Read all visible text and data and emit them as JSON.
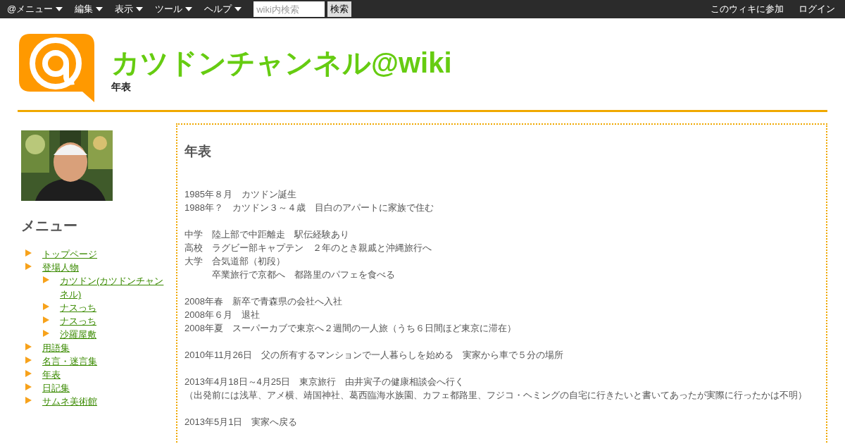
{
  "topbar": {
    "menus": [
      "@メニュー",
      "編集",
      "表示",
      "ツール",
      "ヘルプ"
    ],
    "search": {
      "placeholder": "wiki内検索"
    },
    "search_button": "検索",
    "right_links": [
      "このウィキに参加",
      "ログイン"
    ]
  },
  "header": {
    "title": "カツドンチャンネル@wiki",
    "subtitle": "年表"
  },
  "sidebar": {
    "heading": "メニュー",
    "items": [
      {
        "label": "トップページ"
      },
      {
        "label": "登場人物",
        "children": [
          {
            "label": "カツドン(カツドンチャンネル)"
          },
          {
            "label": "ナスっち"
          },
          {
            "label": "ナスっち"
          },
          {
            "label": "沙羅屋敷"
          }
        ]
      },
      {
        "label": "用語集"
      },
      {
        "label": "名言・迷言集"
      },
      {
        "label": "年表"
      },
      {
        "label": "日記集"
      },
      {
        "label": "サムネ美術館"
      }
    ]
  },
  "content": {
    "heading": "年表",
    "paragraphs": [
      [
        "1985年８月　カツドン誕生",
        "1988年？　カツドン３～４歳　目白のアパートに家族で住む"
      ],
      [
        "中学　陸上部で中距離走　駅伝経験あり",
        "高校　ラグビー部キャプテン　２年のとき親戚と沖縄旅行へ",
        "大学　合気道部（初段）",
        "　　　卒業旅行で京都へ　都路里のパフェを食べる"
      ],
      [
        "2008年春　新卒で青森県の会社へ入社",
        "2008年６月　退社",
        "2008年夏　スーパーカブで東京へ２週間の一人旅（うち６日間ほど東京に滞在）"
      ],
      [
        "2010年11月26日　父の所有するマンションで一人暮らしを始める　実家から車で５分の場所"
      ],
      [
        "2013年4月18日～4月25日　東京旅行　由井寅子の健康相談会へ行く",
        "（出発前には浅草、アメ横、靖国神社、葛西臨海水族園、カフェ都路里、フジコ・ヘミングの自宅に行きたいと書いてあったが実際に行ったかは不明）"
      ],
      [
        "2013年5月1日　実家へ戻る"
      ]
    ]
  }
}
